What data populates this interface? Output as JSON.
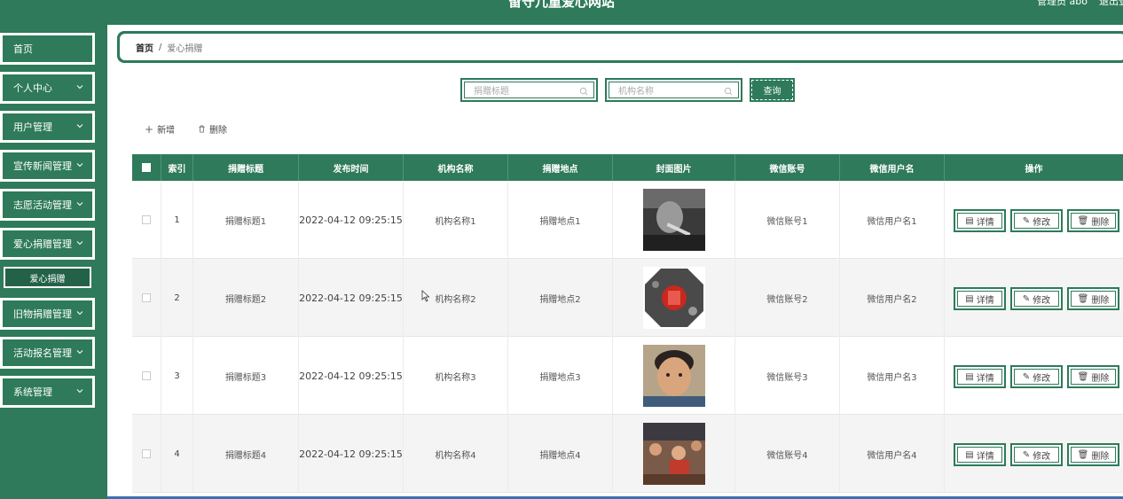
{
  "app": {
    "title": "留守儿童爱心网站",
    "user": "管理员 abo",
    "logout": "退出登"
  },
  "sidebar": {
    "items": [
      {
        "label": "首页",
        "has_arrow": false
      },
      {
        "label": "个人中心",
        "has_arrow": true
      },
      {
        "label": "用户管理",
        "has_arrow": true
      },
      {
        "label": "宣传新闻管理",
        "has_arrow": true
      },
      {
        "label": "志愿活动管理",
        "has_arrow": true
      },
      {
        "label": "爱心捐赠管理",
        "has_arrow": true
      },
      {
        "label": "旧物捐赠管理",
        "has_arrow": true
      },
      {
        "label": "活动报名管理",
        "has_arrow": true
      },
      {
        "label": "系统管理",
        "has_arrow": true
      }
    ],
    "active_sub": "爱心捐赠"
  },
  "breadcrumb": {
    "home": "首页",
    "sep": "/",
    "current": "爱心捐赠"
  },
  "search": {
    "title_placeholder": "捐赠标题",
    "org_placeholder": "机构名称",
    "button": "查询"
  },
  "actions": {
    "add": "新增",
    "delete": "删除"
  },
  "table": {
    "headers": [
      "索引",
      "捐赠标题",
      "发布时间",
      "机构名称",
      "捐赠地点",
      "封面图片",
      "微信账号",
      "微信用户名",
      "操作"
    ],
    "rows": [
      {
        "index": "1",
        "title": "捐赠标题1",
        "time": "2022-04-12 09:25:15",
        "org": "机构名称1",
        "place": "捐赠地点1",
        "wechat": "微信账号1",
        "wechat_name": "微信用户名1"
      },
      {
        "index": "2",
        "title": "捐赠标题2",
        "time": "2022-04-12 09:25:15",
        "org": "机构名称2",
        "place": "捐赠地点2",
        "wechat": "微信账号2",
        "wechat_name": "微信用户名2"
      },
      {
        "index": "3",
        "title": "捐赠标题3",
        "time": "2022-04-12 09:25:15",
        "org": "机构名称3",
        "place": "捐赠地点3",
        "wechat": "微信账号3",
        "wechat_name": "微信用户名3"
      },
      {
        "index": "4",
        "title": "捐赠标题4",
        "time": "2022-04-12 09:25:15",
        "org": "机构名称4",
        "place": "捐赠地点4",
        "wechat": "微信账号4",
        "wechat_name": "微信用户名4"
      }
    ],
    "row_buttons": {
      "detail": "详情",
      "edit": "修改",
      "delete": "删除"
    }
  },
  "colors": {
    "primary": "#2e7a5a",
    "submenu_bg": "#236249",
    "row_alt": "#f4f4f4"
  }
}
